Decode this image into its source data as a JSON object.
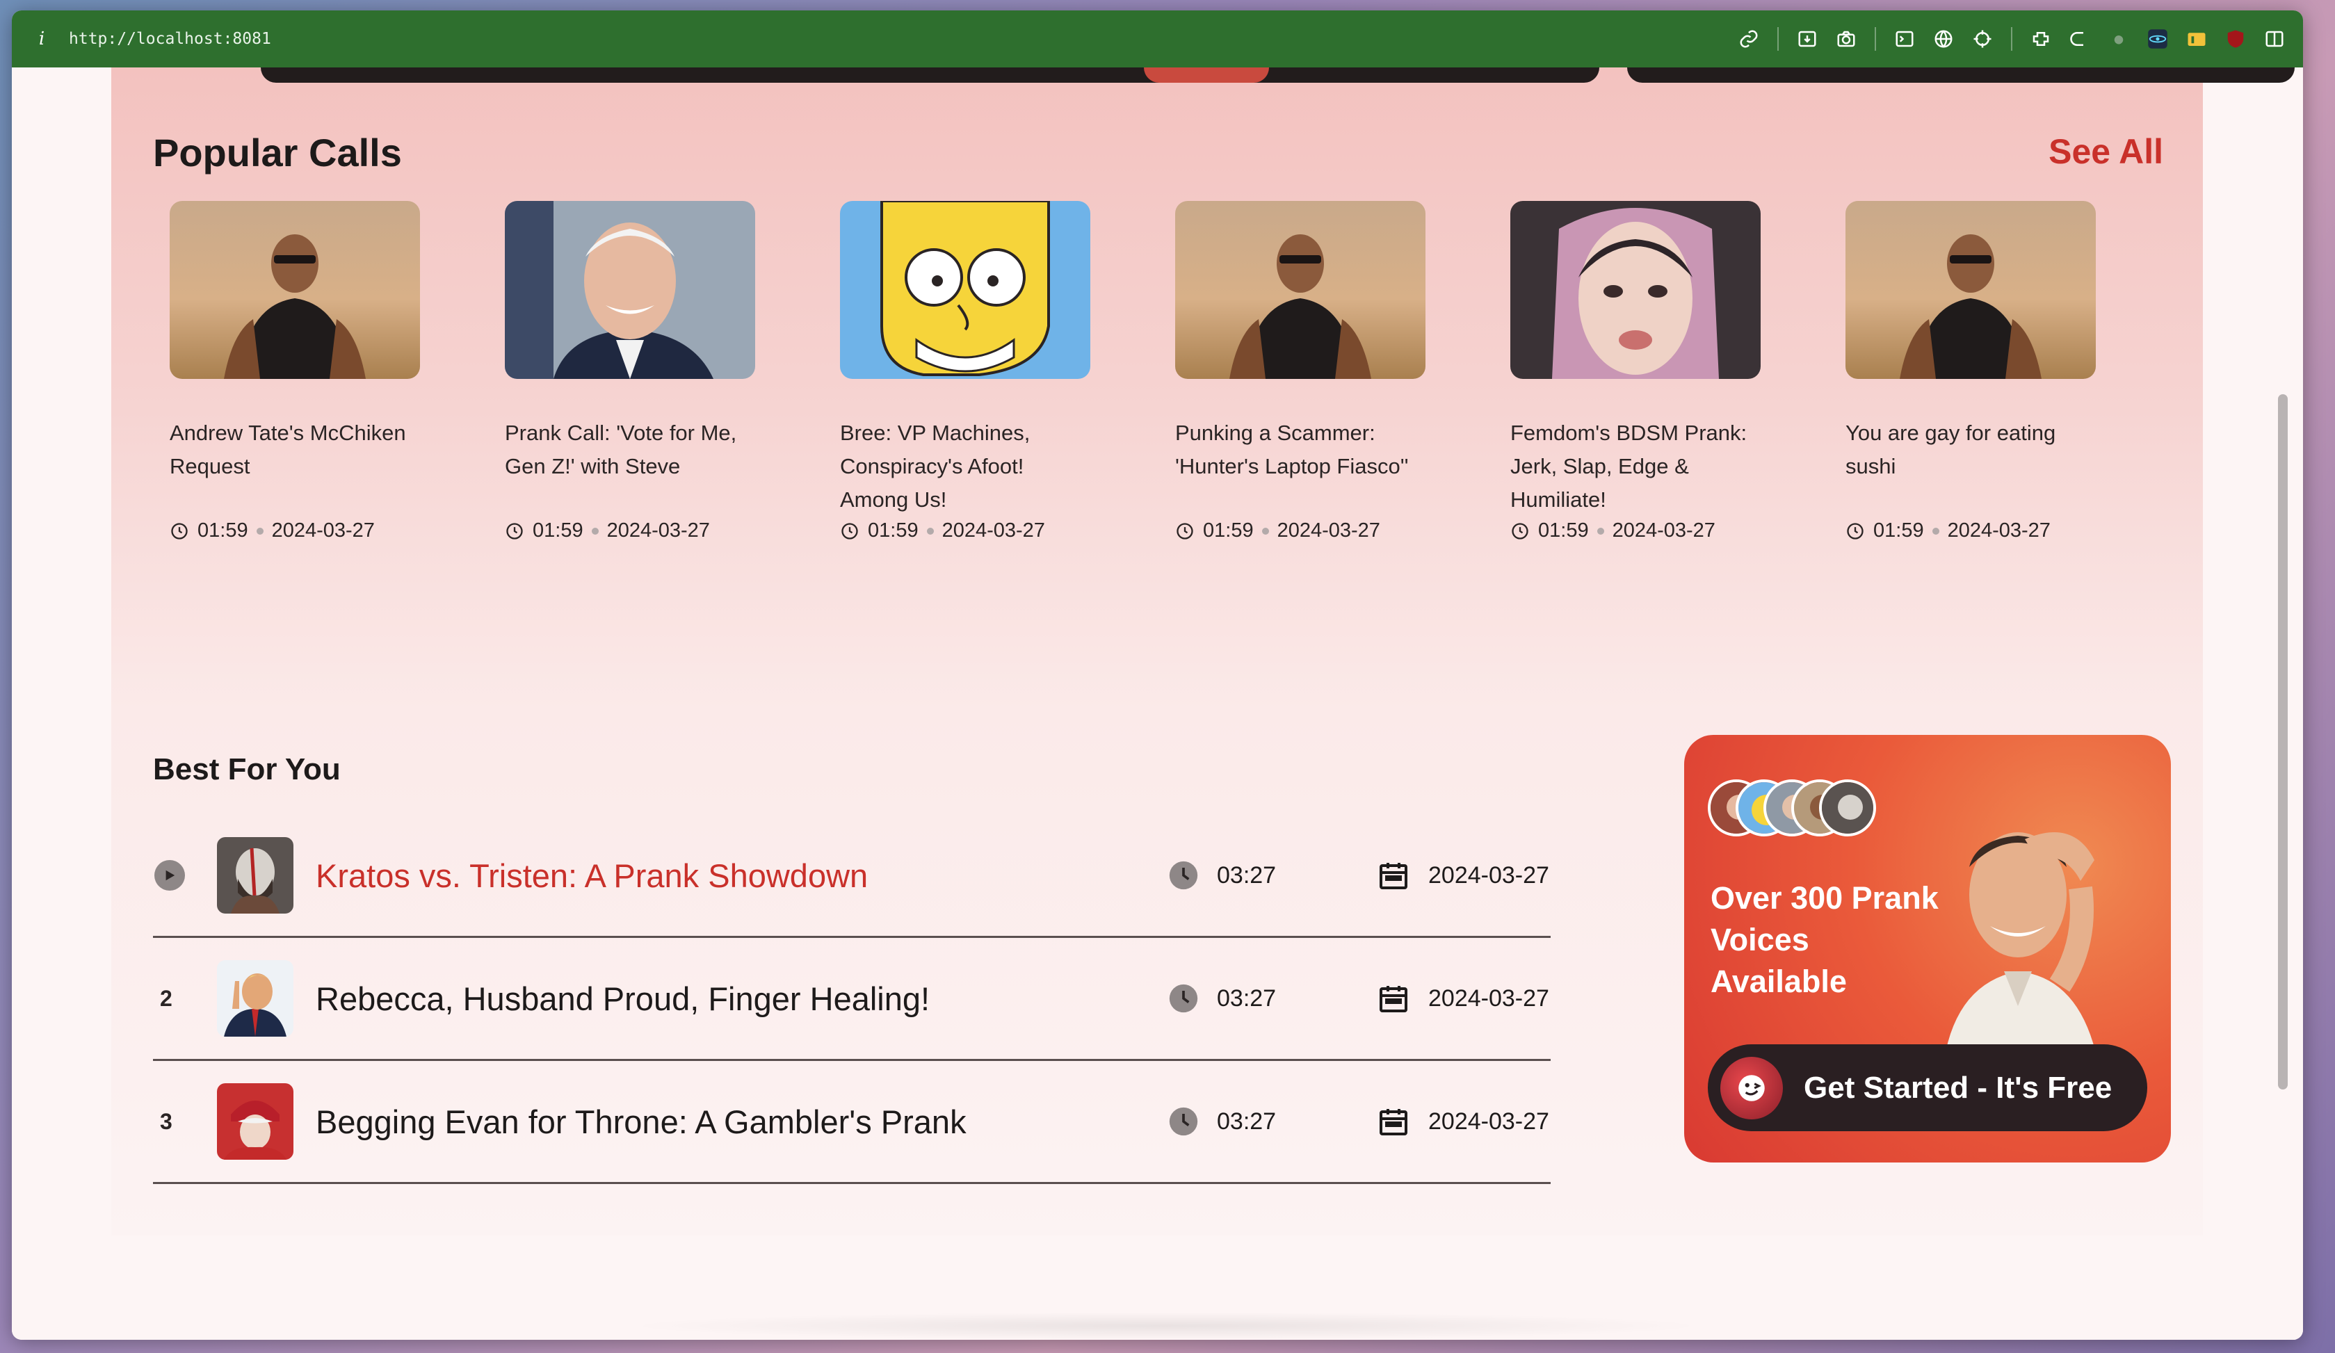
{
  "browser": {
    "info_glyph": "i",
    "url": "http://localhost:8081"
  },
  "popular": {
    "title": "Popular Calls",
    "see_all": "See All",
    "cards": [
      {
        "title": "Andrew Tate's McChiken Request",
        "duration": "01:59",
        "date": "2024-03-27",
        "thumb": "man-sunglasses-desert"
      },
      {
        "title": "Prank Call: 'Vote for Me, Gen Z!' with Steve",
        "duration": "01:59",
        "date": "2024-03-27",
        "thumb": "smiling-old-man"
      },
      {
        "title": "Bree: VP Machines, Conspiracy's Afoot! Among Us!",
        "duration": "01:59",
        "date": "2024-03-27",
        "thumb": "cartoon-yellow-face"
      },
      {
        "title": "Punking a Scammer: 'Hunter's Laptop Fiasco''",
        "duration": "01:59",
        "date": "2024-03-27",
        "thumb": "man-sunglasses-desert"
      },
      {
        "title": "Femdom's BDSM Prank: Jerk, Slap, Edge & Humiliate!",
        "duration": "01:59",
        "date": "2024-03-27",
        "thumb": "pink-hair-portrait"
      },
      {
        "title": "You are gay for eating sushi",
        "duration": "01:59",
        "date": "2024-03-27",
        "thumb": "man-sunglasses-desert"
      }
    ]
  },
  "best": {
    "title": "Best For You",
    "rows": [
      {
        "rank": "",
        "title": "Kratos vs. Tristen: A Prank Showdown",
        "duration": "03:27",
        "date": "2024-03-27",
        "active": true
      },
      {
        "rank": "2",
        "title": "Rebecca, Husband Proud, Finger Healing!",
        "duration": "03:27",
        "date": "2024-03-27",
        "active": false
      },
      {
        "rank": "3",
        "title": "Begging Evan for Throne: A Gambler's Prank",
        "duration": "03:27",
        "date": "2024-03-27",
        "active": false
      }
    ]
  },
  "promo": {
    "headline": "Over 300 Prank Voices Available",
    "button": "Get Started - It's Free"
  },
  "colors": {
    "toolbar": "#2e6f2e",
    "accent_red": "#c9302a",
    "promo_orange": "#ea5a3a"
  }
}
